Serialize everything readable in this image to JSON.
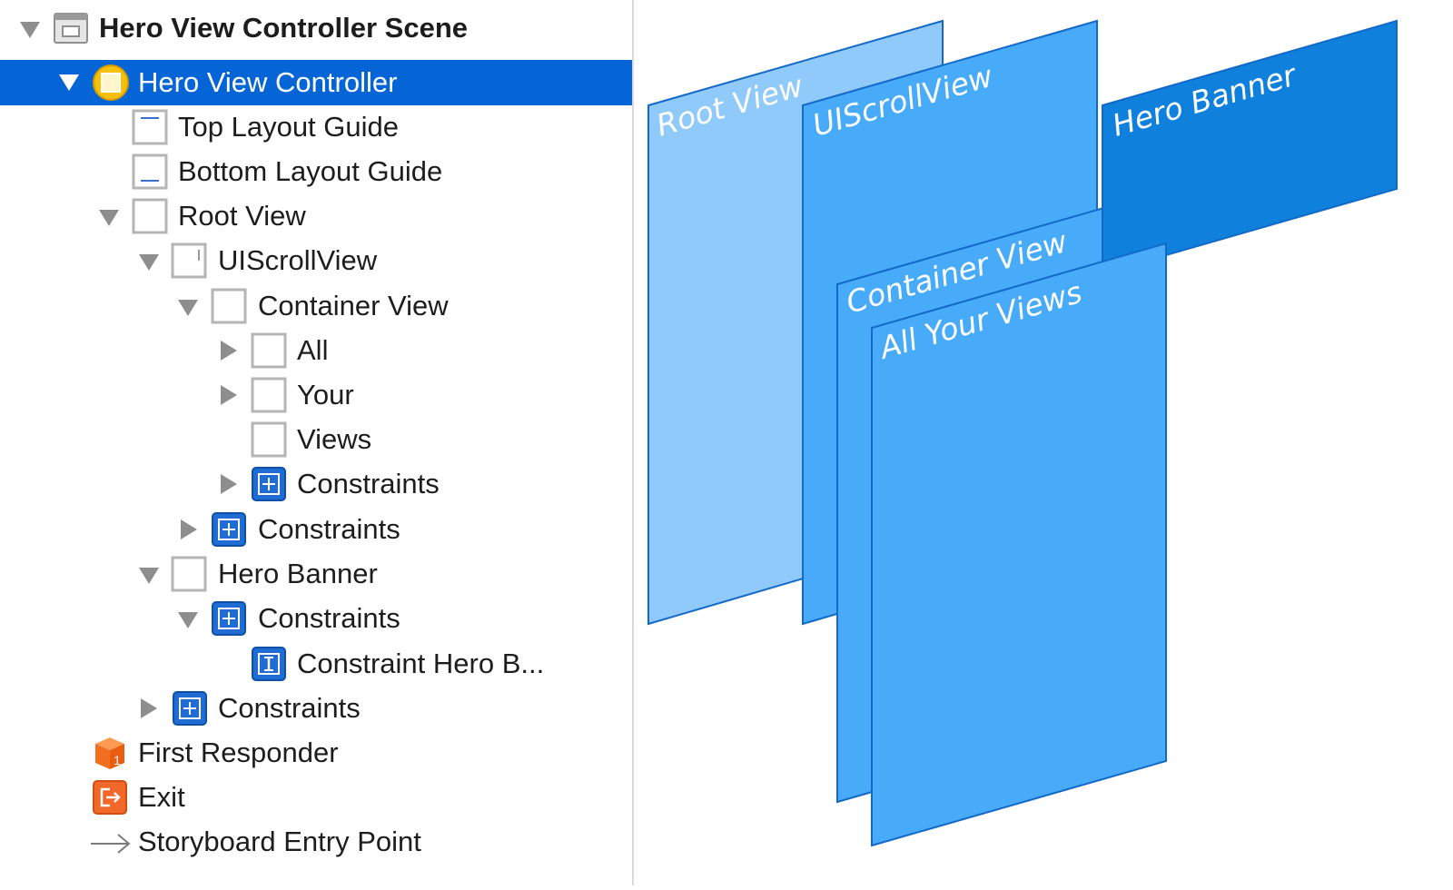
{
  "outline": {
    "items": [
      {
        "label": "Hero View Controller Scene",
        "icon": "scene-icon",
        "disclosure": "down",
        "bold": true
      },
      {
        "label": "Hero View Controller",
        "icon": "view-controller-icon",
        "disclosure": "down",
        "selected": true
      },
      {
        "label": "Top Layout Guide",
        "icon": "top-layout-guide-icon"
      },
      {
        "label": "Bottom Layout Guide",
        "icon": "bottom-layout-guide-icon"
      },
      {
        "label": "Root View",
        "icon": "view-icon",
        "disclosure": "down"
      },
      {
        "label": "UIScrollView",
        "icon": "scroll-view-icon",
        "disclosure": "down"
      },
      {
        "label": "Container View",
        "icon": "view-icon",
        "disclosure": "down"
      },
      {
        "label": "All",
        "icon": "view-icon",
        "disclosure": "right"
      },
      {
        "label": "Your",
        "icon": "view-icon",
        "disclosure": "right"
      },
      {
        "label": "Views",
        "icon": "view-icon"
      },
      {
        "label": "Constraints",
        "icon": "constraints-icon",
        "disclosure": "right"
      },
      {
        "label": "Constraints",
        "icon": "constraints-icon",
        "disclosure": "right"
      },
      {
        "label": "Hero Banner",
        "icon": "view-icon",
        "disclosure": "down"
      },
      {
        "label": "Constraints",
        "icon": "constraints-icon",
        "disclosure": "down"
      },
      {
        "label": "Constraint Hero B...",
        "icon": "constraint-icon"
      },
      {
        "label": "Constraints",
        "icon": "constraints-icon",
        "disclosure": "right"
      },
      {
        "label": "First Responder",
        "icon": "first-responder-icon"
      },
      {
        "label": "Exit",
        "icon": "exit-icon"
      },
      {
        "label": "Storyboard Entry Point",
        "icon": "entry-point-arrow-icon"
      }
    ]
  },
  "layers": {
    "root_view": "Root View",
    "scroll_view": "UIScrollView",
    "hero_banner": "Hero Banner",
    "container_view": "Container View",
    "all_your_views": "All Your Views"
  },
  "colors": {
    "selection": "#0565d6",
    "layer_light": "#90cafb",
    "layer_mid": "#47abf9",
    "layer_dark": "#0f80dc",
    "layer_stroke": "#1369c8"
  }
}
